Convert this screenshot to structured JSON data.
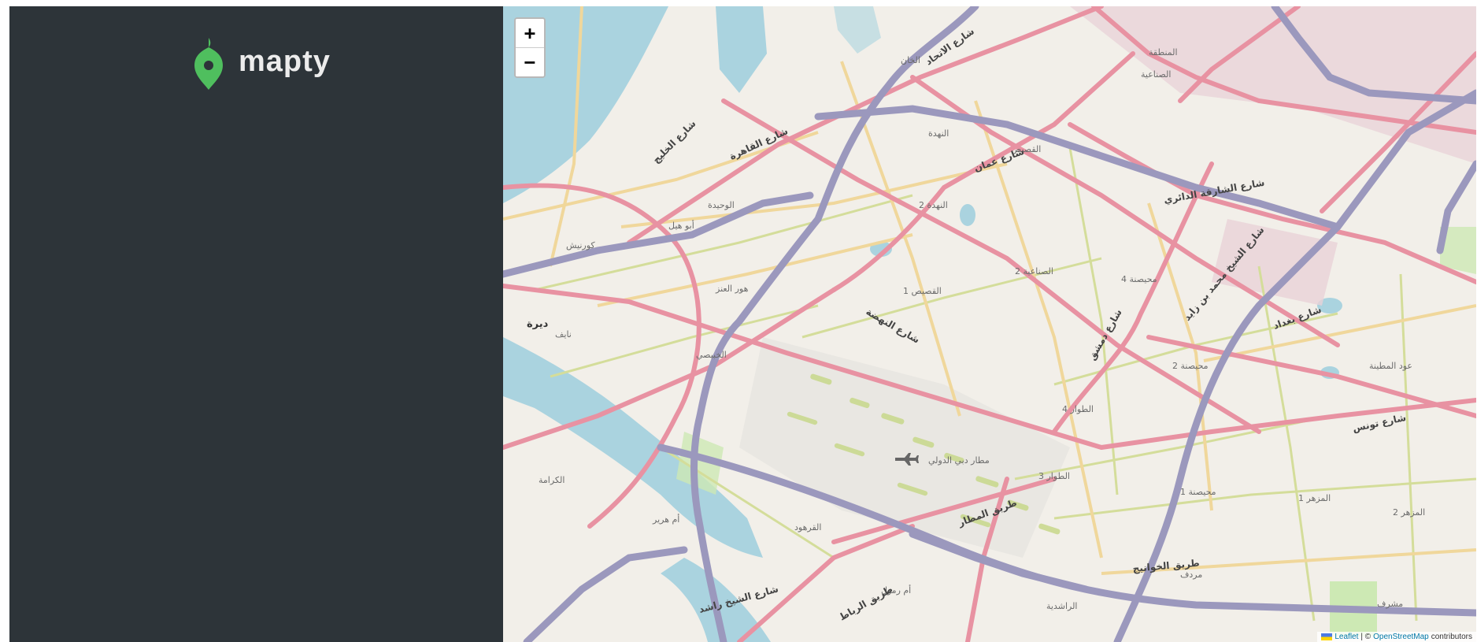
{
  "app": {
    "name": "mapty"
  },
  "sidebar": {
    "logo_text": "mapty"
  },
  "map": {
    "zoom_in_label": "+",
    "zoom_out_label": "−",
    "attribution": {
      "leaflet": "Leaflet",
      "separator": "| ©",
      "osm": "OpenStreetMap",
      "suffix": "contributors"
    },
    "place_labels": [
      "ديرة",
      "نايف",
      "كورنيش",
      "الوحيدة",
      "أبو هيل",
      "هور العنز",
      "الخبيصي",
      "النهدة",
      "النهدة 2",
      "القصيص",
      "القصيص 1",
      "الصناعية 2",
      "محيصنة 4",
      "محيصنة 2",
      "محيصنة 1",
      "مطار دبي الدولي",
      "الطوار 4",
      "الطوار 3",
      "عود المطينة",
      "المزهر 1",
      "المزهر 2",
      "القرهود",
      "أم رمول",
      "أم هرير",
      "الكرامة",
      "مردف",
      "الراشدية",
      "مشرف",
      "المنطقة",
      "الصناعية",
      "الخان"
    ],
    "road_labels": [
      "شارع الخليج",
      "شارع القاهرة",
      "شارع الاتحاد",
      "شارع بغداد",
      "شارع عمان",
      "شارع النهضة",
      "طريق المطار",
      "طريق الخوانيج",
      "شارع تونس",
      "شارع الشيخ محمد بن زايد",
      "شارع الشيخ راشد",
      "طريق الرباط",
      "شارع الشارقة الدائري",
      "شارع دمشق"
    ],
    "colors": {
      "water": "#aad3df",
      "land": "#f2efe9",
      "primary_road": "#e892a2",
      "motorway": "#9b98bd",
      "secondary_road": "#f0d79b",
      "tertiary_road": "#d4dd9a",
      "industrial": "#e8d2d7",
      "park": "#cde9b4",
      "airport": "#e9e7e2"
    }
  }
}
